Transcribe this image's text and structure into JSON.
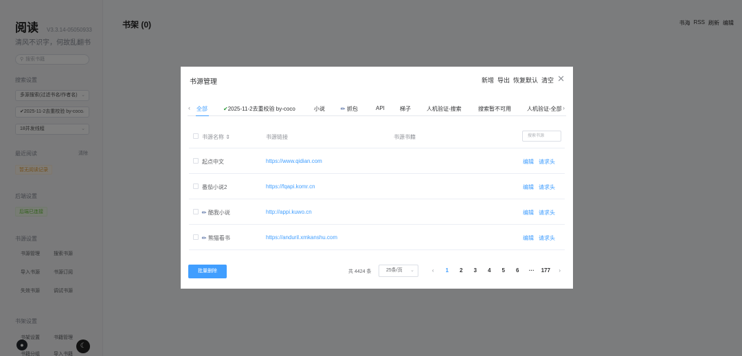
{
  "app": {
    "title": "阅读",
    "version": "V3.3.14-05050933",
    "slogan": "清风不识字，何故乱翻书",
    "search_placeholder": "搜索书籍"
  },
  "sidebar": {
    "search_settings_title": "搜索设置",
    "search_mode": "多源搜索(过滤书名/作者名)",
    "search_source": "✔2025-11-2去重校验 by-coco",
    "search_limit": "18并发线程",
    "recent_title": "最近阅读",
    "recent_clear": "清除",
    "recent_empty": "暂无阅读记录",
    "backend_title": "后端设置",
    "backend_status": "后端已连接",
    "source_settings_title": "书源设置",
    "source_links": [
      "书源管理",
      "搜索书源",
      "导入书源",
      "书源订阅",
      "失效书源",
      "调试书源"
    ],
    "shelf_settings_title": "书架设置",
    "shelf_links": [
      "书架设置",
      "书籍管理",
      "书籍分组",
      "导入书籍"
    ]
  },
  "main": {
    "shelf_title": "书架 (0)",
    "nav": [
      "书海",
      "RSS",
      "刷新",
      "编辑"
    ]
  },
  "dialog": {
    "title": "书源管理",
    "actions": [
      "新增",
      "导出",
      "恢复默认",
      "清空"
    ],
    "tabs": [
      {
        "label": "全部",
        "active": true
      },
      {
        "label": "2025-11-2去重校验 by-coco",
        "icon": "check-icon"
      },
      {
        "label": "小说"
      },
      {
        "label": "抓包",
        "icon": "paperclip-icon"
      },
      {
        "label": "API"
      },
      {
        "label": "梯子"
      },
      {
        "label": "人机验证-搜索"
      },
      {
        "label": "搜索暂不可用"
      },
      {
        "label": "人机验证-全部"
      }
    ],
    "columns": {
      "name": "书源名称 ⇕",
      "url": "书源链接",
      "group": "书源书籍",
      "search_placeholder": "搜索书源"
    },
    "rows": [
      {
        "name": "起点中文",
        "url": "https://www.qidian.com",
        "icon": ""
      },
      {
        "name": "番茄小说2",
        "url": "https://fqapi.komr.cn",
        "icon": ""
      },
      {
        "name": "酷我小说",
        "url": "http://appi.kuwo.cn",
        "icon": "paperclip-icon"
      },
      {
        "name": "熊猫看书",
        "url": "https://anduril.xmkanshu.com",
        "icon": "paperclip-icon"
      }
    ],
    "row_ops": {
      "edit": "编辑",
      "headers": "请求头"
    },
    "batch_delete": "批量删除",
    "total": "共 4424 条",
    "page_size": "25条/页",
    "pages": [
      "1",
      "2",
      "3",
      "4",
      "5",
      "6",
      "···",
      "177"
    ],
    "current_page": "1"
  }
}
